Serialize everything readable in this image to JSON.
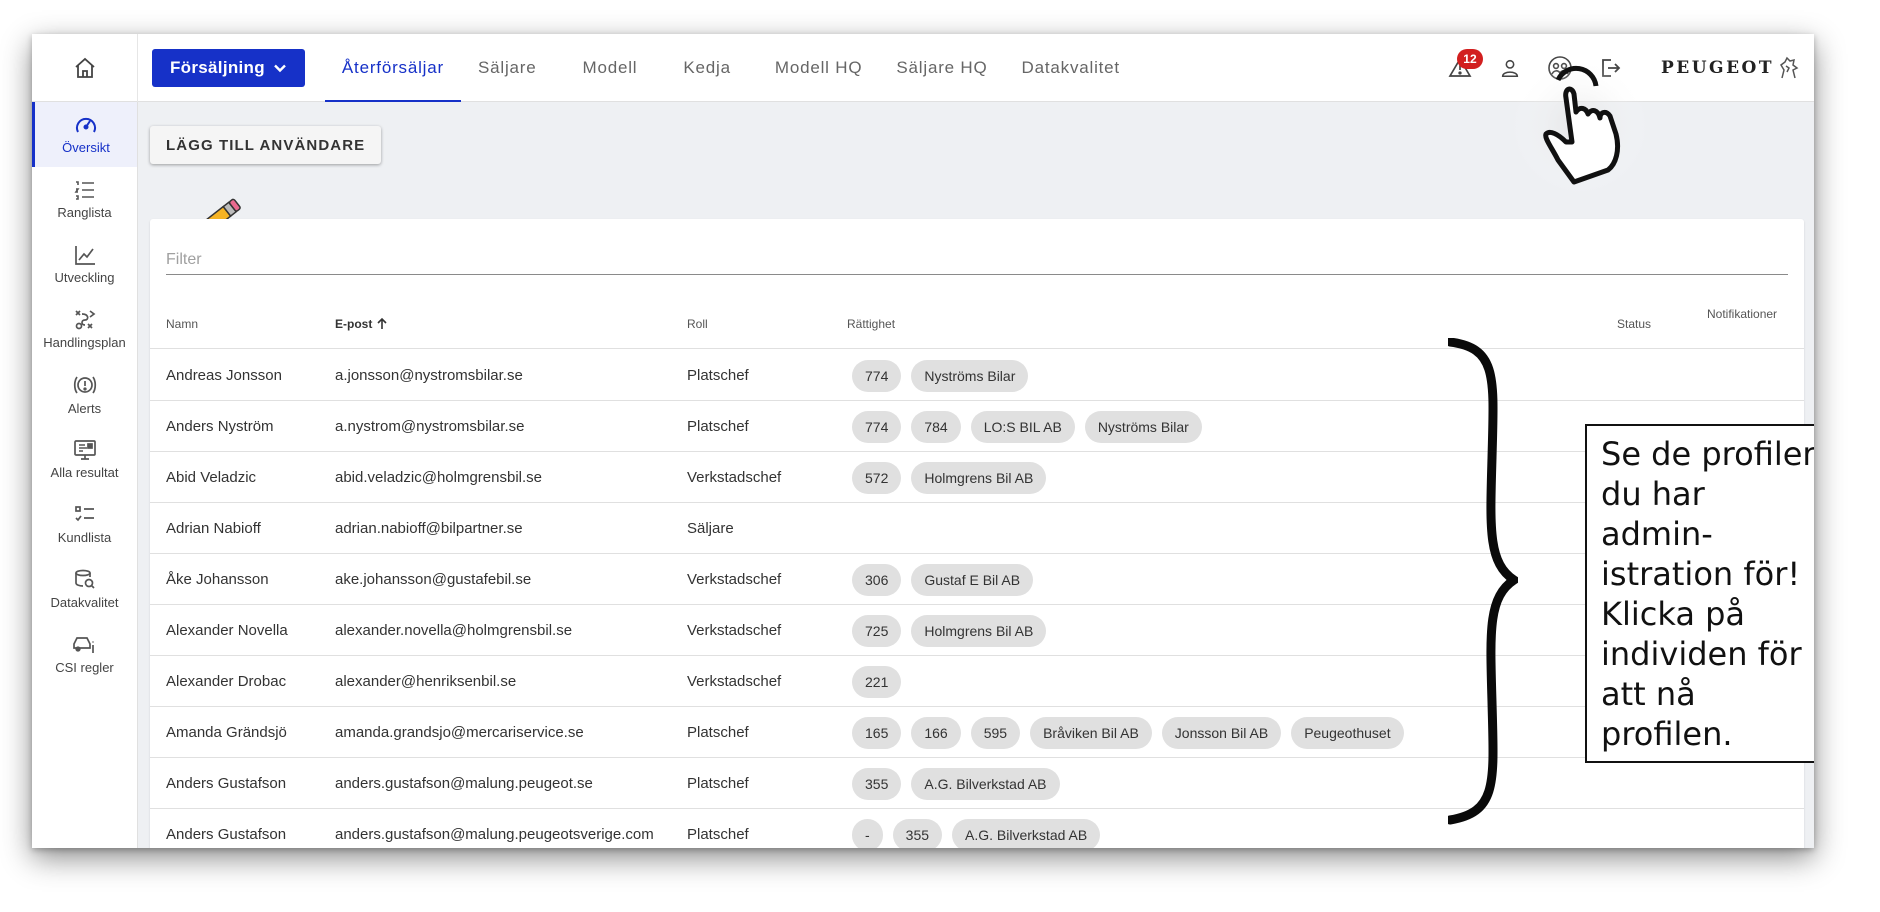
{
  "topbar": {
    "brand_button": "Försäljning",
    "tabs": [
      "Återförsäljar",
      "Säljare",
      "Modell",
      "Kedja",
      "Modell HQ",
      "Säljare HQ",
      "Datakvalitet"
    ],
    "alert_count": "12",
    "logo_text": "PEUGEOT",
    "accent": "#1631c8"
  },
  "sidebar": {
    "items": [
      {
        "label": "Översikt",
        "icon": "speedometer-icon"
      },
      {
        "label": "Ranglista",
        "icon": "ranked-list-icon"
      },
      {
        "label": "Utveckling",
        "icon": "line-chart-icon"
      },
      {
        "label": "Handlingsplan",
        "icon": "action-plan-icon"
      },
      {
        "label": "Alerts",
        "icon": "alert-circle-icon"
      },
      {
        "label": "Alla resultat",
        "icon": "monitor-icon"
      },
      {
        "label": "Kundlista",
        "icon": "checklist-icon"
      },
      {
        "label": "Datakvalitet",
        "icon": "database-search-icon"
      },
      {
        "label": "CSI regler",
        "icon": "car-info-icon"
      }
    ]
  },
  "main": {
    "add_user_button": "LÄGG TILL ANVÄNDARE",
    "filter_placeholder": "Filter",
    "columns": {
      "name": "Namn",
      "email": "E-post",
      "role": "Roll",
      "rights": "Rättighet",
      "status": "Status",
      "notifications": "Notifikationer"
    },
    "rows": [
      {
        "name": "Andreas Jonsson",
        "email": "a.jonsson@nystromsbilar.se",
        "role": "Platschef",
        "rights": [
          "774",
          "Nyströms Bilar"
        ]
      },
      {
        "name": "Anders Nyström",
        "email": "a.nystrom@nystromsbilar.se",
        "role": "Platschef",
        "rights": [
          "774",
          "784",
          "LO:S BIL AB",
          "Nyströms Bilar"
        ]
      },
      {
        "name": "Abid Veladzic",
        "email": "abid.veladzic@holmgrensbil.se",
        "role": "Verkstadschef",
        "rights": [
          "572",
          "Holmgrens Bil AB"
        ]
      },
      {
        "name": "Adrian Nabioff",
        "email": "adrian.nabioff@bilpartner.se",
        "role": "Säljare",
        "rights": []
      },
      {
        "name": "Åke Johansson",
        "email": "ake.johansson@gustafebil.se",
        "role": "Verkstadschef",
        "rights": [
          "306",
          "Gustaf E Bil AB"
        ]
      },
      {
        "name": "Alexander Novella",
        "email": "alexander.novella@holmgrensbil.se",
        "role": "Verkstadschef",
        "rights": [
          "725",
          "Holmgrens Bil AB"
        ]
      },
      {
        "name": "Alexander Drobac",
        "email": "alexander@henriksenbil.se",
        "role": "Verkstadschef",
        "rights": [
          "221"
        ]
      },
      {
        "name": "Amanda Grändsjö",
        "email": "amanda.grandsjo@mercariservice.se",
        "role": "Platschef",
        "rights": [
          "165",
          "166",
          "595",
          "Bråviken Bil AB",
          "Jonsson Bil AB",
          "Peugeothuset"
        ]
      },
      {
        "name": "Anders Gustafson",
        "email": "anders.gustafson@malung.peugeot.se",
        "role": "Platschef",
        "rights": [
          "355",
          "A.G. Bilverkstad AB"
        ]
      },
      {
        "name": "Anders Gustafson",
        "email": "anders.gustafson@malung.peugeotsverige.com",
        "role": "Platschef",
        "rights": [
          "-",
          "355",
          "A.G. Bilverkstad AB"
        ]
      }
    ]
  },
  "annotation": {
    "lines": [
      "Se de profiler",
      "du har",
      "admin-",
      "istration för!",
      "Klicka på",
      "individen för",
      "att nå",
      "profilen."
    ]
  }
}
